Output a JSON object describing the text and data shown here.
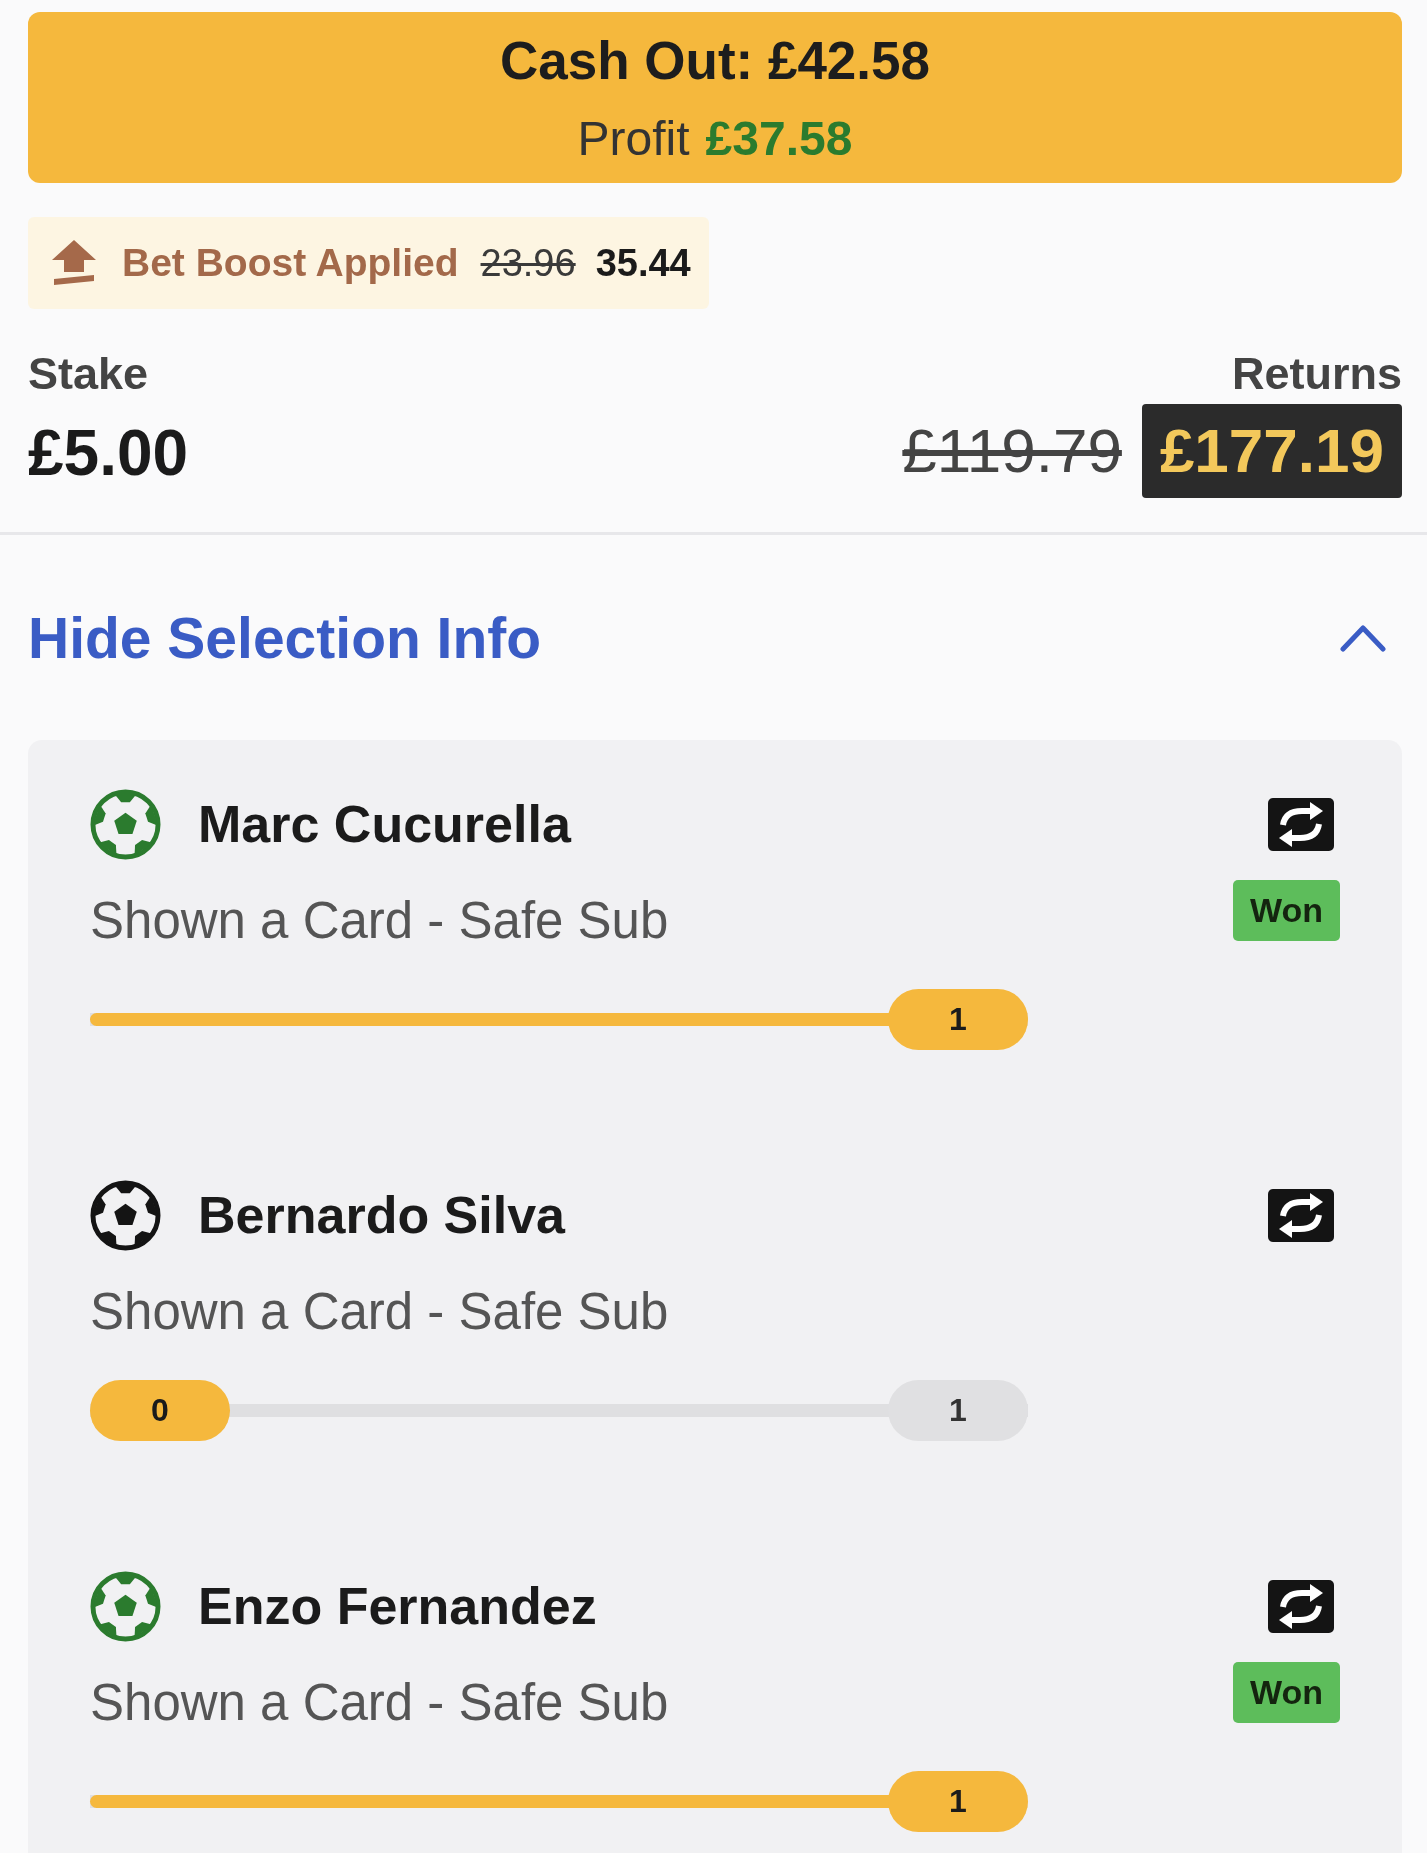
{
  "cash_out": {
    "label": "Cash Out: £42.58",
    "profit_label": "Profit",
    "profit": "£37.58"
  },
  "bet_boost": {
    "label": "Bet Boost Applied",
    "old_odds": "23.96",
    "new_odds": "35.44"
  },
  "stake": {
    "label": "Stake",
    "amount": "£5.00"
  },
  "returns": {
    "label": "Returns",
    "old_amount": "£119.79",
    "amount": "£177.19"
  },
  "selection_toggle": {
    "label": "Hide Selection Info",
    "expanded": true
  },
  "selections": [
    {
      "name": "Marc Cucurella",
      "market": "Shown a Card - Safe Sub",
      "won": true,
      "result": "Won",
      "progress": {
        "level": 1,
        "current": "1"
      }
    },
    {
      "name": "Bernardo Silva",
      "market": "Shown a Card - Safe Sub",
      "won": false,
      "progress": {
        "level": 0,
        "current": "0",
        "target": "1"
      }
    },
    {
      "name": "Enzo Fernandez",
      "market": "Shown a Card - Safe Sub",
      "won": true,
      "result": "Won",
      "progress": {
        "level": 1,
        "current": "1"
      }
    }
  ]
}
